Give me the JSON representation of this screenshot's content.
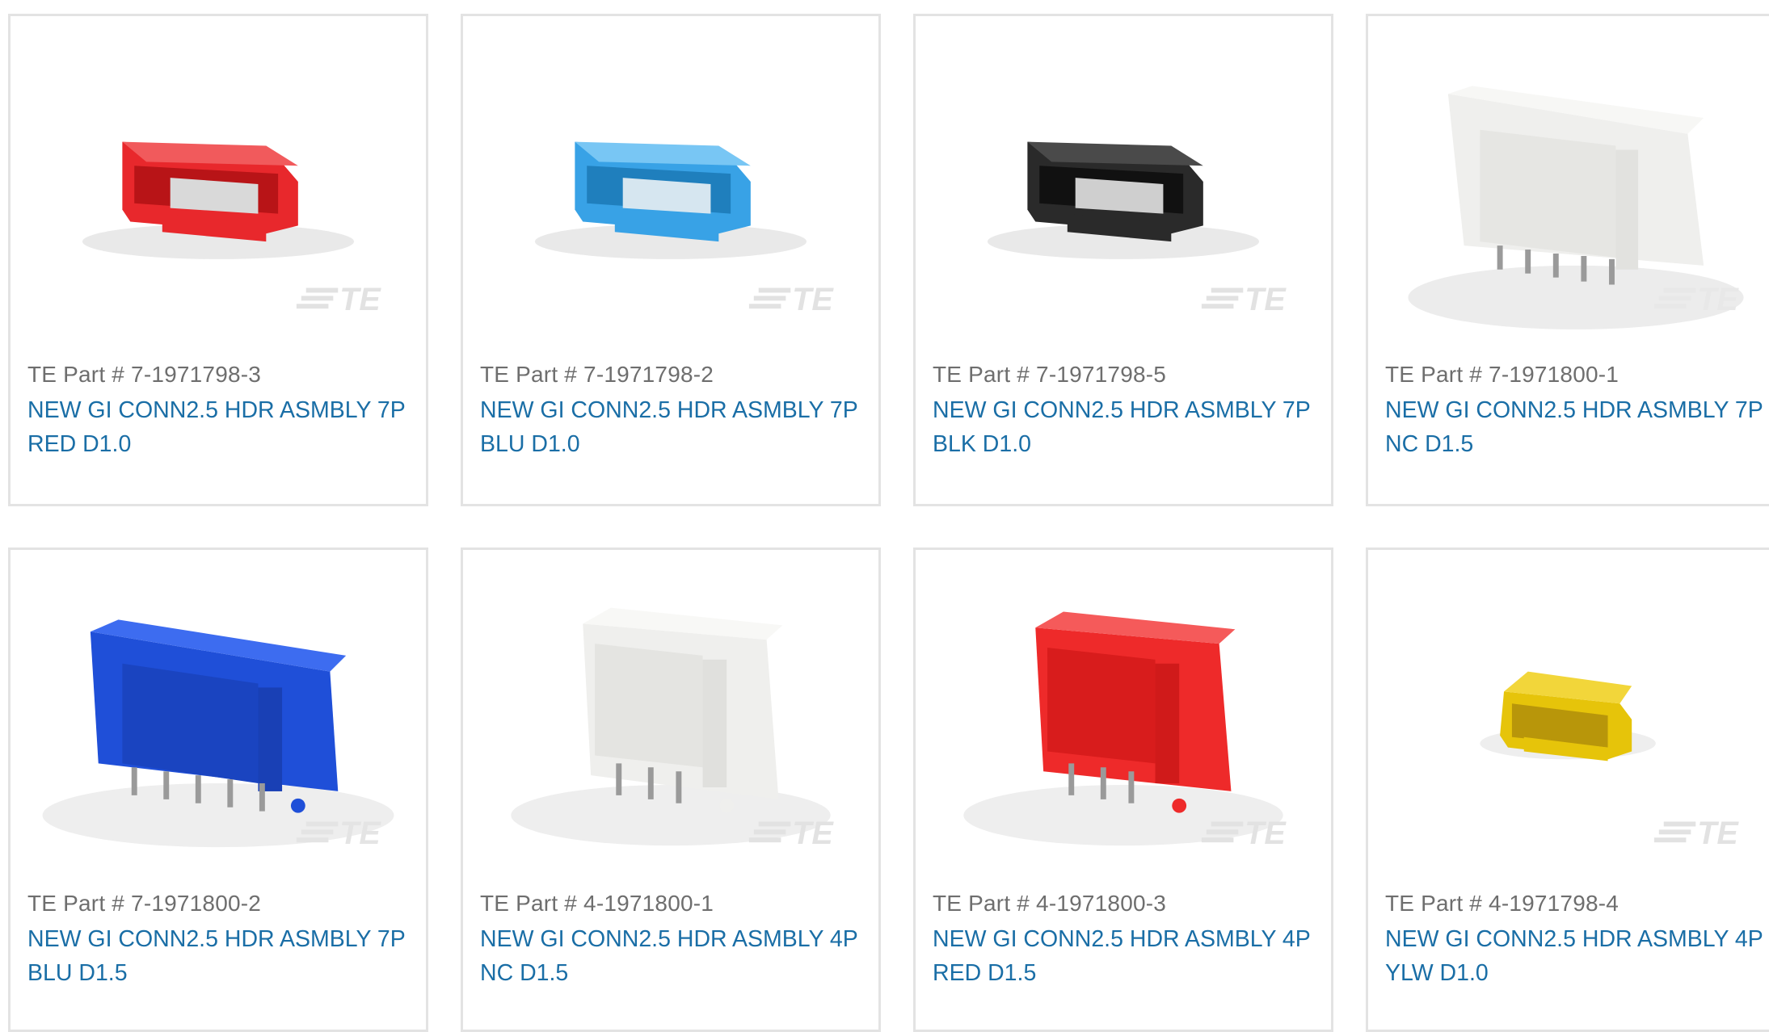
{
  "products": [
    {
      "part_label": "TE Part #",
      "part_number": "7-1971798-3",
      "title_line1": "NEW GI CONN2.5 HDR ASMBLY 7P",
      "title_line2": "RED D1.0",
      "color": "#e8282c",
      "icon": "connector-red-icon"
    },
    {
      "part_label": "TE Part #",
      "part_number": "7-1971798-2",
      "title_line1": "NEW GI CONN2.5 HDR ASMBLY 7P",
      "title_line2": "BLU D1.0",
      "color": "#38a2e6",
      "icon": "connector-light-blue-icon"
    },
    {
      "part_label": "TE Part #",
      "part_number": "7-1971798-5",
      "title_line1": "NEW GI CONN2.5 HDR ASMBLY 7P",
      "title_line2": "BLK D1.0",
      "color": "#2a2a2a",
      "icon": "connector-black-icon"
    },
    {
      "part_label": "TE Part #",
      "part_number": "7-1971800-1",
      "title_line1": "NEW GI CONN2.5 HDR ASMBLY 7P",
      "title_line2": "NC D1.5",
      "color": "#eeeeec",
      "icon": "connector-natural-icon"
    },
    {
      "part_label": "TE Part #",
      "part_number": "7-1971800-2",
      "title_line1": "NEW GI CONN2.5 HDR ASMBLY 7P",
      "title_line2": "BLU D1.5",
      "color": "#1f4fd8",
      "icon": "connector-blue-icon"
    },
    {
      "part_label": "TE Part #",
      "part_number": "4-1971800-1",
      "title_line1": "NEW GI CONN2.5 HDR ASMBLY 4P",
      "title_line2": "NC D1.5",
      "color": "#efefed",
      "icon": "connector-natural-icon"
    },
    {
      "part_label": "TE Part #",
      "part_number": "4-1971800-3",
      "title_line1": "NEW GI CONN2.5 HDR ASMBLY 4P",
      "title_line2": "RED D1.5",
      "color": "#ee2a2a",
      "icon": "connector-red-icon"
    },
    {
      "part_label": "TE Part #",
      "part_number": "4-1971798-4",
      "title_line1": "NEW GI CONN2.5 HDR ASMBLY 4P",
      "title_line2": "YLW D1.0",
      "color": "#e6c40a",
      "icon": "connector-yellow-icon"
    }
  ],
  "watermark": "TE",
  "colors": {
    "link": "#1a6ea6",
    "muted": "#6e6e6e",
    "border": "#e3e3e3"
  }
}
